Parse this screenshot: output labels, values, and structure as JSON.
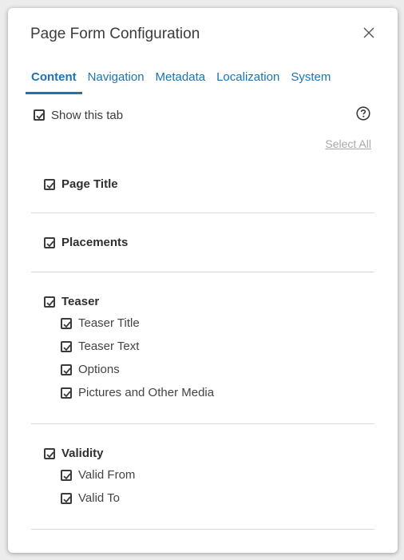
{
  "dialog": {
    "title": "Page Form Configuration"
  },
  "tabs": [
    {
      "label": "Content",
      "active": true
    },
    {
      "label": "Navigation",
      "active": false
    },
    {
      "label": "Metadata",
      "active": false
    },
    {
      "label": "Localization",
      "active": false
    },
    {
      "label": "System",
      "active": false
    }
  ],
  "show_tab": {
    "label": "Show this tab",
    "checked": true
  },
  "select_all": "Select All",
  "sections": [
    {
      "label": "Page Title",
      "checked": true,
      "items": []
    },
    {
      "label": "Placements",
      "checked": true,
      "items": []
    },
    {
      "label": "Teaser",
      "checked": true,
      "items": [
        {
          "label": "Teaser Title",
          "checked": true
        },
        {
          "label": "Teaser Text",
          "checked": true
        },
        {
          "label": "Options",
          "checked": true
        },
        {
          "label": "Pictures and Other Media",
          "checked": true
        }
      ]
    },
    {
      "label": "Validity",
      "checked": true,
      "items": [
        {
          "label": "Valid From",
          "checked": true
        },
        {
          "label": "Valid To",
          "checked": true
        }
      ]
    }
  ],
  "icons": {
    "close": "close-icon",
    "help": "help-circle-icon",
    "checkbox": "checkbox-checked-icon"
  },
  "colors": {
    "accent": "#1f73b0",
    "text": "#3c3c3c",
    "muted_link": "#a8a8a8",
    "divider": "#d8d8d8"
  }
}
